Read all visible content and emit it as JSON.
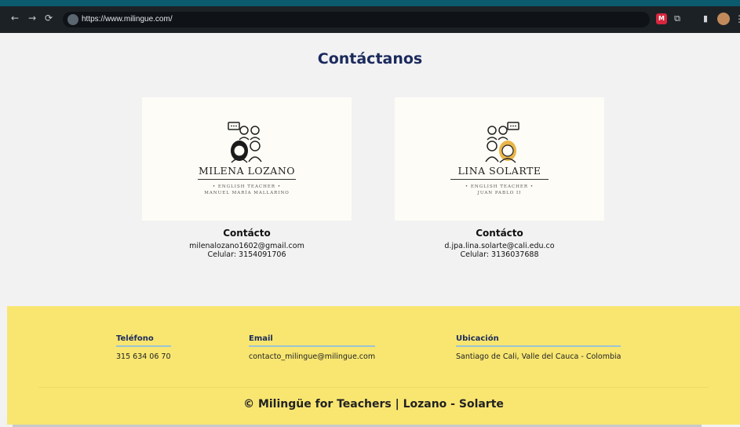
{
  "browser": {
    "nav_back": "←",
    "nav_forward": "→",
    "nav_reload": "⟳",
    "url": "https://www.milingue.com/",
    "ext_badge": "M",
    "ext_puzzle": "⧉",
    "ext_panel": "▮",
    "menu": "⋮"
  },
  "page": {
    "title": "Contáctanos"
  },
  "teachers": [
    {
      "logo_name": "MILENA LOZANO",
      "logo_role": "• ENGLISH TEACHER •",
      "logo_school": "MANUEL MARÍA MALLARINO",
      "contact_heading": "Contácto",
      "email": "milenalozano1602@gmail.com",
      "phone": "Celular: 3154091706",
      "accent": "#1a1a1a"
    },
    {
      "logo_name": "LINA SOLARTE",
      "logo_role": "• ENGLISH TEACHER •",
      "logo_school": "JUAN PABLO II",
      "contact_heading": "Contácto",
      "email": "d.jpa.lina.solarte@cali.edu.co",
      "phone": "Celular: 3136037688",
      "accent": "#eab54a"
    }
  ],
  "footer": {
    "phone_label": "Teléfono",
    "phone_value": "315 634 06 70",
    "email_label": "Email",
    "email_value": "contacto_milingue@milingue.com",
    "location_label": "Ubicación",
    "location_value": "Santiago de Cali, Valle del Cauca - Colombia",
    "copyright": "© Milingüe for Teachers | Lozano - Solarte"
  },
  "colors": {
    "footer_bg": "#f8e671",
    "title": "#1b2a5c",
    "underline": "#9bc4d4"
  }
}
